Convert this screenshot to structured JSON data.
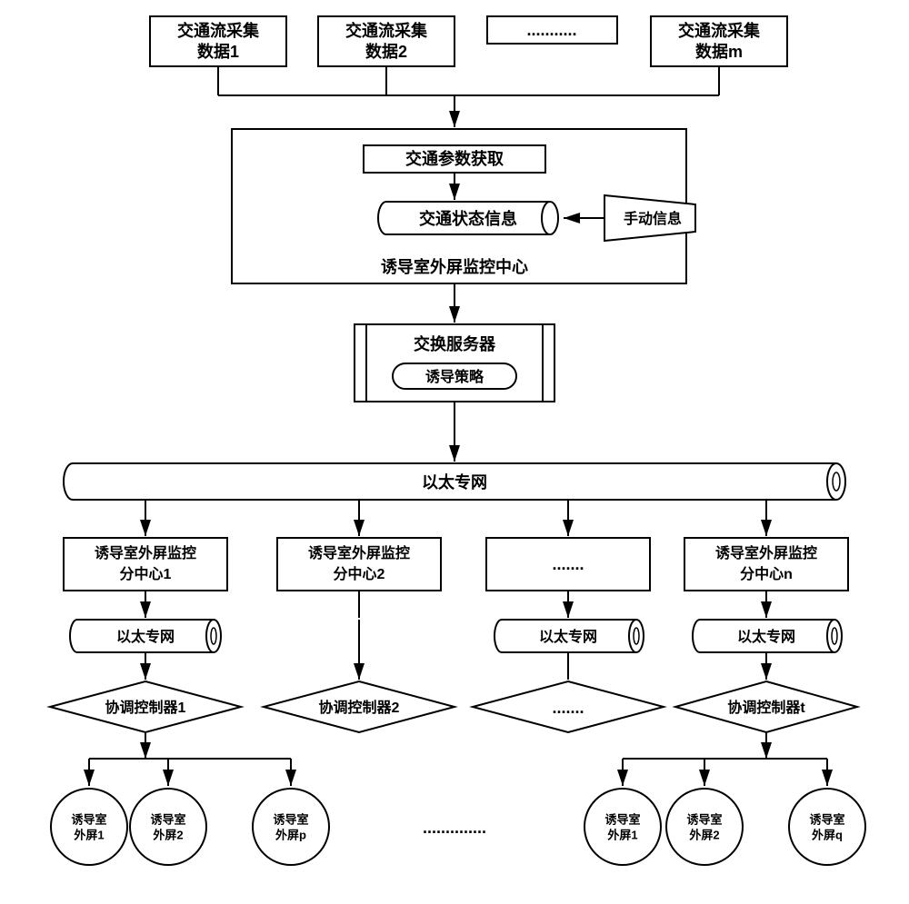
{
  "top_sources": {
    "s1": "交通流采集\n数据1",
    "s2": "交通流采集\n数据2",
    "dots": "...........",
    "sm": "交通流采集\n数据m"
  },
  "center": {
    "param_acq": "交通参数获取",
    "status_info": "交通状态信息",
    "manual_info": "手动信息",
    "center_label": "诱导室外屏监控中心"
  },
  "exchange": {
    "server": "交换服务器",
    "strategy": "诱导策略"
  },
  "ethernet_main": "以太专网",
  "subcenters": {
    "sc1": "诱导室外屏监控\n分中心1",
    "sc2": "诱导室外屏监控\n分中心2",
    "dots": ".......",
    "scn": "诱导室外屏监控\n分中心n"
  },
  "ethernets": {
    "e1": "以太专网",
    "e3": "以太专网",
    "e4": "以太专网"
  },
  "controllers": {
    "c1": "协调控制器1",
    "c2": "协调控制器2",
    "dots": ".......",
    "ct": "协调控制器t"
  },
  "screens_left": {
    "s1": "诱导室\n外屏1",
    "s2": "诱导室\n外屏2",
    "sp": "诱导室\n外屏p"
  },
  "screens_dots": "..............",
  "screens_right": {
    "s1": "诱导室\n外屏1",
    "s2": "诱导室\n外屏2",
    "sq": "诱导室\n外屏q"
  }
}
